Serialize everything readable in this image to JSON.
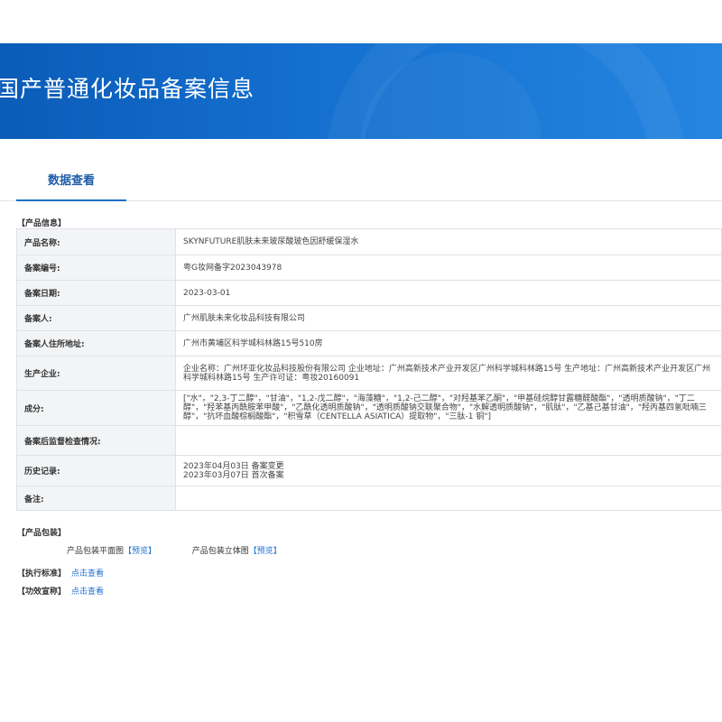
{
  "banner": {
    "title": "国产普通化妆品备案信息"
  },
  "tabs": {
    "active": "数据查看"
  },
  "product_info": {
    "section_title": "【产品信息】",
    "rows": [
      {
        "label": "产品名称:",
        "value": "SKYNFUTURE肌肤未来玻尿酸玻色因舒缓保湿水"
      },
      {
        "label": "备案编号:",
        "value": "粤G妆网备字2023043978"
      },
      {
        "label": "备案日期:",
        "value": "2023-03-01"
      },
      {
        "label": "备案人:",
        "value": "广州肌肤未来化妆品科技有限公司"
      },
      {
        "label": "备案人住所地址:",
        "value": "广州市黄埔区科学城科林路15号510房"
      },
      {
        "label": "生产企业:",
        "value": "企业名称：广州环亚化妆品科技股份有限公司 企业地址：广州高新技术产业开发区广州科学城科林路15号 生产地址：广州高新技术产业开发区广州科学城科林路15号 生产许可证：粤妆20160091"
      },
      {
        "label": "成分:",
        "value": "[\"水\"，\"2,3-丁二醇\"，\"甘油\"，\"1,2-戊二醇\"，\"海藻糖\"，\"1,2-己二醇\"，\"对羟基苯乙酮\"，\"甲基硅烷醇甘露糖醛酸酯\"，\"透明质酸钠\"，\"丁二醇\"，\"羟苯基丙酰胺苯甲酸\"，\"乙酰化透明质酸钠\"，\"透明质酸钠交联聚合物\"，\"水解透明质酸钠\"，\"肌肽\"，\"乙基己基甘油\"，\"羟丙基四氢吡喃三醇\"，\"抗坏血酸棕榈酸酯\"，\"积雪草（CENTELLA ASIATICA）提取物\"，\"三肽-1 铜\"]"
      },
      {
        "label": "备案后监督检查情况:",
        "value": ""
      },
      {
        "label": "历史记录:",
        "value": "2023年04月03日 备案变更",
        "value2": "2023年03月07日 首次备案"
      },
      {
        "label": "备注:",
        "value": ""
      }
    ]
  },
  "packaging": {
    "section_title": "【产品包装】",
    "flat_label": "产品包装平面图",
    "flat_link": "【预览】",
    "solid_label": "产品包装立体图",
    "solid_link": "【预览】"
  },
  "standard": {
    "label": "【执行标准】",
    "link": "点击查看"
  },
  "efficacy": {
    "label": "【功效宣称】",
    "link": "点击查看"
  }
}
